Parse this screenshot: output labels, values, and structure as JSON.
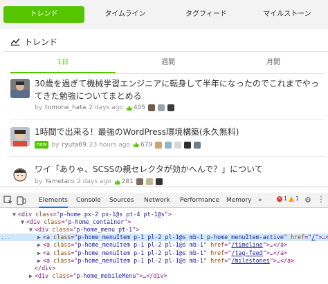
{
  "nav": {
    "items": [
      "トレンド",
      "タイムライン",
      "タグフィード",
      "マイルストーン"
    ],
    "active_index": 0
  },
  "trend": {
    "heading": "トレンド",
    "tabs": [
      "1日",
      "週間",
      "月間"
    ],
    "active_tab": 0
  },
  "items": [
    {
      "title": "30歳を過ぎて機械学習エンジニアに転身して半年になったのでこれまでやってきた勉強についてまとめる",
      "by": "by",
      "author": "tomone_hata",
      "time": "2 days ago",
      "likes": "405",
      "new_badge": ""
    },
    {
      "title": "1時間で出来る！最強のWordPress環境構築(永久無料)",
      "by": "by",
      "author": "ryuta69",
      "time": "23 hours ago",
      "likes": "679",
      "new_badge": "new"
    },
    {
      "title": "ワイ「ありゃ、SCSSの親セレクタが効かへんで？」について",
      "by": "by",
      "author": "Yametaro",
      "time": "2 days ago",
      "likes": "281",
      "new_badge": ""
    }
  ],
  "devtools": {
    "tabs": [
      "Elements",
      "Console",
      "Sources",
      "Network",
      "Performance",
      "Memory"
    ],
    "active_tab": 0,
    "more_tabs": "»",
    "error_count": "1",
    "warning_count": "1",
    "lines": [
      {
        "indent": "",
        "pre": "▼",
        "tag": "div",
        "attrs": [
          [
            "class",
            "p-home px-2 px-1@s pt-4 pt-1@s"
          ]
        ],
        "end": ">"
      },
      {
        "indent": "  ",
        "pre": "▼",
        "tag": "div",
        "attrs": [
          [
            "class",
            "p-home_container"
          ]
        ],
        "end": ">"
      },
      {
        "indent": "    ",
        "pre": "▼",
        "tag": "div",
        "attrs": [
          [
            "class",
            "p-home_menu pt-1"
          ]
        ],
        "end": ">"
      },
      {
        "indent": "      ",
        "pre": "▶",
        "tag": "a",
        "attrs": [
          [
            "class",
            "p-home_menuItem p-1 pl-2 pl-1@s mb-1 p-home_menuItem-active"
          ],
          [
            "href",
            "/"
          ]
        ],
        "end": ">…</a>",
        "selected": true
      },
      {
        "indent": "      ",
        "pre": "▶",
        "tag": "a",
        "attrs": [
          [
            "class",
            "p-home_menuItem p-1 pl-2 pl-1@s mb-1"
          ],
          [
            "href",
            "/timeline"
          ]
        ],
        "end": ">…</a>"
      },
      {
        "indent": "      ",
        "pre": "▶",
        "tag": "a",
        "attrs": [
          [
            "class",
            "p-home_menuItem p-1 pl-2 pl-1@s mb-1"
          ],
          [
            "href",
            "/tag-feed"
          ]
        ],
        "end": ">…</a>"
      },
      {
        "indent": "      ",
        "pre": "▶",
        "tag": "a",
        "attrs": [
          [
            "class",
            "p-home_menuItem p-1 pl-2 pl-1@s mb-1"
          ],
          [
            "href",
            "/milestones"
          ]
        ],
        "end": ">…</a>"
      },
      {
        "indent": "    ",
        "pre": "",
        "tag": "/div",
        "attrs": [],
        "end": ">"
      },
      {
        "indent": "    ",
        "pre": "▶",
        "tag": "div",
        "attrs": [
          [
            "class",
            "p-home_mobileMenu"
          ]
        ],
        "end": ">…</div>"
      }
    ],
    "selected_marker": "...",
    "selected_suffix": "== $0"
  },
  "colors": {
    "accent": "#55c500",
    "devtools_selected": "#cfe8fc",
    "tag": "#881280",
    "attr": "#994500",
    "value": "#1a1aa6"
  }
}
